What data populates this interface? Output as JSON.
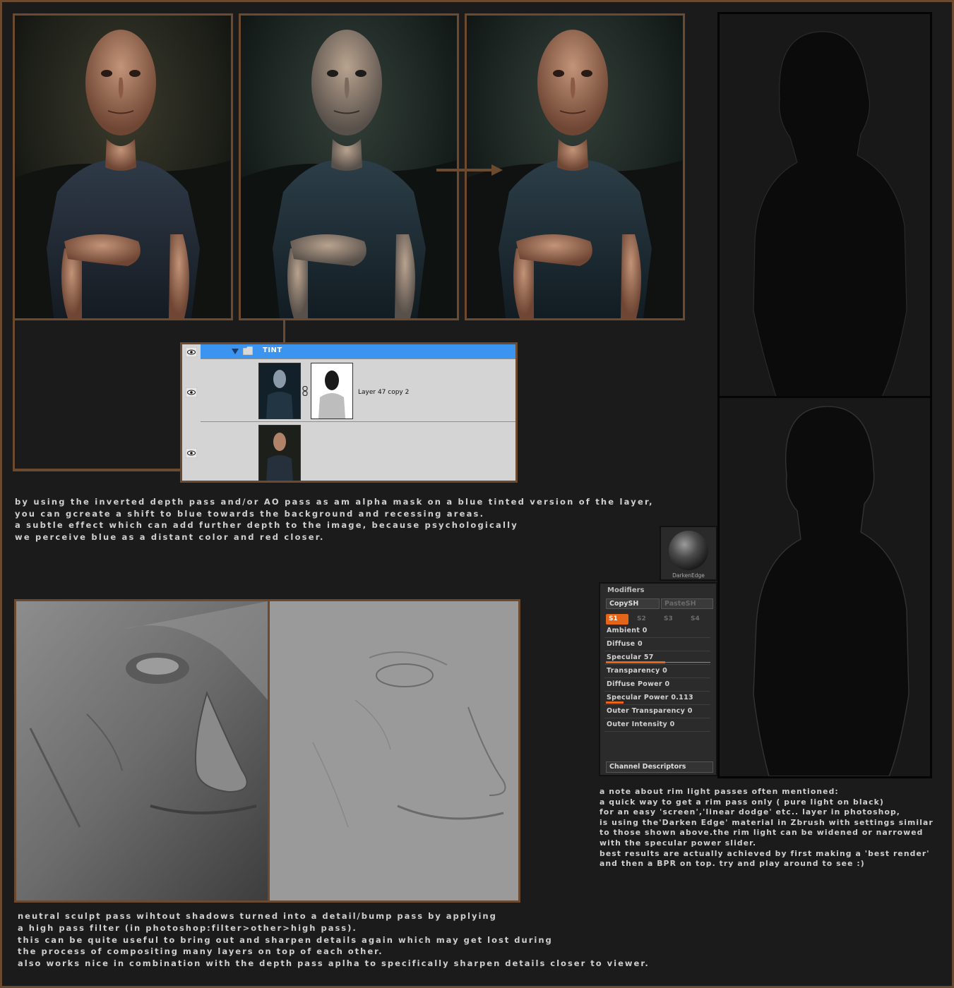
{
  "layers_panel": {
    "group_name": "TINT",
    "layer1_name": "Layer 47 copy 2"
  },
  "captions": {
    "tint_text": "by using the inverted depth pass and/or AO pass as am alpha mask on a blue tinted version of the layer,\nyou can gcreate a shift to blue towards the background and recessing areas.\na subtle effect which can add further depth to the image, because psychologically\nwe perceive blue as a distant color and red closer.",
    "rim_note": "a note about rim light passes often mentioned:\na quick way to get a rim pass only ( pure light on black)\nfor an easy 'screen','linear dodge' etc.. layer in photoshop,\nis using the'Darken Edge' material in Zbrush with settings similar\nto those shown above.the rim light can be widened or narrowed\nwith the specular power slider.\nbest results are actually achieved by first making a 'best render'\nand then a BPR on top. try and play around to see :)",
    "sculpt_text": "neutral sculpt pass wihtout shadows turned into a detail/bump pass by applying\na high pass filter (in photoshop:filter>other>high pass).\nthis can be quite useful to bring out and sharpen details again which may get lost during\nthe process of compositing many layers on top of each other.\nalso works nice in combination with the depth pass aplha to specifically sharpen details closer to viewer."
  },
  "material": {
    "name": "DarkenEdge"
  },
  "modifiers": {
    "title": "Modifiers",
    "copy_sh": "CopySH",
    "paste_sh": "PasteSH",
    "slots": [
      "S1",
      "S2",
      "S3",
      "S4"
    ],
    "ambient": "Ambient 0",
    "diffuse": "Diffuse 0",
    "specular": "Specular 57",
    "specular_value": 0.57,
    "transparency": "Transparency 0",
    "diffuse_power": "Diffuse Power 0",
    "specular_power": "Specular Power 0.113",
    "specular_power_value": 0.113,
    "outer_transparency": "Outer Transparency 0",
    "outer_intensity": "Outer Intensity 0",
    "channel_descriptors": "Channel Descriptors"
  },
  "colors": {
    "frame_brown": "#6b4a30",
    "background": "#1b1b1b",
    "highlight_blue": "#3b94ef",
    "slider_orange": "#e8661a"
  }
}
